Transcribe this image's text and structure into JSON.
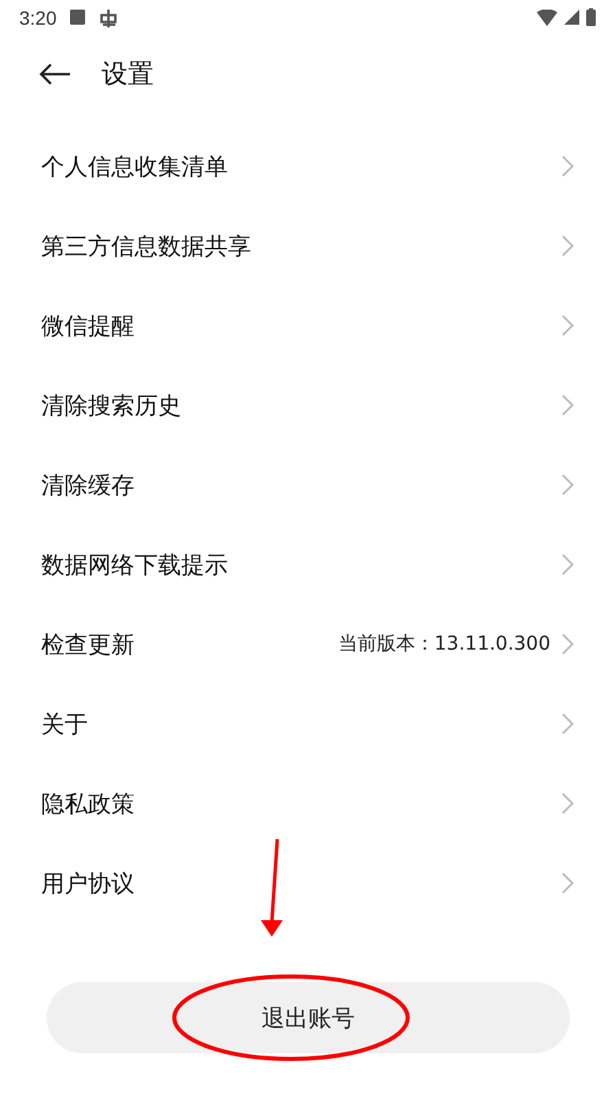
{
  "status_bar": {
    "time": "3:20"
  },
  "header": {
    "title": "设置"
  },
  "items": [
    {
      "label": "个人信息收集清单"
    },
    {
      "label": "第三方信息数据共享"
    },
    {
      "label": "微信提醒"
    },
    {
      "label": "清除搜索历史"
    },
    {
      "label": "清除缓存"
    },
    {
      "label": "数据网络下载提示"
    },
    {
      "label": "检查更新",
      "value": "当前版本：13.11.0.300"
    },
    {
      "label": "关于"
    },
    {
      "label": "隐私政策"
    },
    {
      "label": "用户协议"
    }
  ],
  "logout_button": {
    "label": "退出账号"
  }
}
